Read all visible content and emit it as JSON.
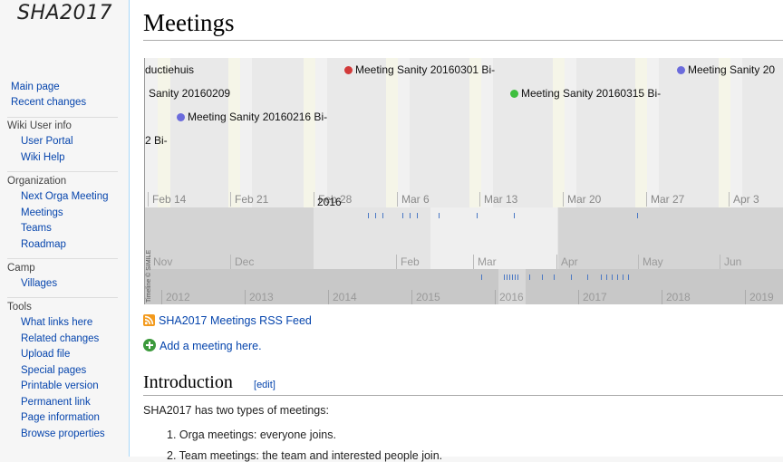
{
  "sidebar": {
    "logo": "SHA2017",
    "nav": [
      "Main page",
      "Recent changes"
    ],
    "sections": [
      {
        "heading": "Wiki User info",
        "items": [
          "User Portal",
          "Wiki Help"
        ]
      },
      {
        "heading": "Organization",
        "items": [
          "Next Orga Meeting",
          "Meetings",
          "Teams",
          "Roadmap"
        ]
      },
      {
        "heading": "Camp",
        "items": [
          "Villages"
        ]
      },
      {
        "heading": "Tools",
        "items": [
          "What links here",
          "Related changes",
          "Upload file",
          "Special pages",
          "Printable version",
          "Permanent link",
          "Page information",
          "Browse properties"
        ]
      }
    ]
  },
  "page": {
    "title": "Meetings"
  },
  "timeline": {
    "events": [
      {
        "label": "ductiehuis",
        "color": ""
      },
      {
        "label": "Meeting Sanity 20160301 Bi-",
        "color": "#d23a3a"
      },
      {
        "label": "Meeting Sanity 20",
        "color": "#6b6bdc"
      },
      {
        "label": "Sanity 20160209",
        "color": ""
      },
      {
        "label": "Meeting Sanity 20160315 Bi-",
        "color": "#3fbf3f"
      },
      {
        "label": "Meeting Sanity 20160216 Bi-",
        "color": "#6b6bdc"
      },
      {
        "label": "2 Bi-",
        "color": ""
      }
    ],
    "day_ticks": [
      "Feb 14",
      "Feb 21",
      "Feb 28",
      "Mar 6",
      "Mar 13",
      "Mar 20",
      "Mar 27",
      "Apr 3"
    ],
    "month_ticks": [
      "Nov",
      "Dec",
      "2016",
      "Feb",
      "Mar",
      "Apr",
      "May",
      "Jun"
    ],
    "year_ticks": [
      "2012",
      "2013",
      "2014",
      "2015",
      "2016",
      "2017",
      "2018",
      "2019"
    ],
    "credit": "Timeline © SIMILE"
  },
  "links": {
    "rss": "SHA2017 Meetings RSS Feed",
    "add": "Add a meeting here."
  },
  "intro": {
    "heading": "Introduction",
    "edit": "edit",
    "text": "SHA2017 has two types of meetings:",
    "items": [
      "Orga meetings: everyone joins.",
      "Team meetings: the team and interested people join."
    ]
  }
}
